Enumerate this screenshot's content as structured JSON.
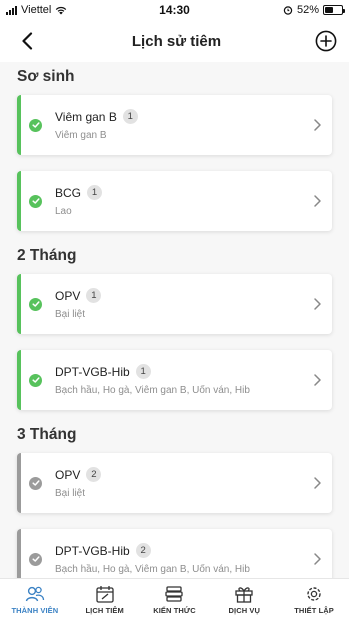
{
  "status_bar": {
    "carrier": "Viettel",
    "time": "14:30",
    "battery_percent": "52%",
    "battery_level": 0.52
  },
  "header": {
    "title": "Lịch sử tiêm",
    "back_icon": "chevron-left-icon",
    "add_icon": "plus-circle-icon"
  },
  "sections": [
    {
      "title": "Sơ sinh",
      "items": [
        {
          "name": "Viêm gan B",
          "dose": "1",
          "disease": "Viêm gan B",
          "status": "done"
        },
        {
          "name": "BCG",
          "dose": "1",
          "disease": "Lao",
          "status": "done"
        }
      ]
    },
    {
      "title": "2 Tháng",
      "items": [
        {
          "name": "OPV",
          "dose": "1",
          "disease": "Bại liệt",
          "status": "done"
        },
        {
          "name": "DPT-VGB-Hib",
          "dose": "1",
          "disease": "Bạch hầu, Ho gà, Viêm gan B, Uốn ván, Hib",
          "status": "done"
        }
      ]
    },
    {
      "title": "3 Tháng",
      "items": [
        {
          "name": "OPV",
          "dose": "2",
          "disease": "Bại liệt",
          "status": "pending"
        },
        {
          "name": "DPT-VGB-Hib",
          "dose": "2",
          "disease": "Bạch hầu, Ho gà, Viêm gan B, Uốn ván, Hib",
          "status": "pending"
        }
      ]
    }
  ],
  "tabs": [
    {
      "label": "THÀNH VIÊN",
      "icon": "members-icon",
      "active": true
    },
    {
      "label": "LỊCH TIÊM",
      "icon": "calendar-icon",
      "active": false
    },
    {
      "label": "KIẾN THỨC",
      "icon": "knowledge-icon",
      "active": false
    },
    {
      "label": "DỊCH VỤ",
      "icon": "gift-icon",
      "active": false
    },
    {
      "label": "THIẾT LẬP",
      "icon": "settings-icon",
      "active": false
    }
  ],
  "colors": {
    "done": "#57c25c",
    "pending": "#9b9b9b",
    "active_tab": "#3b82c4"
  }
}
